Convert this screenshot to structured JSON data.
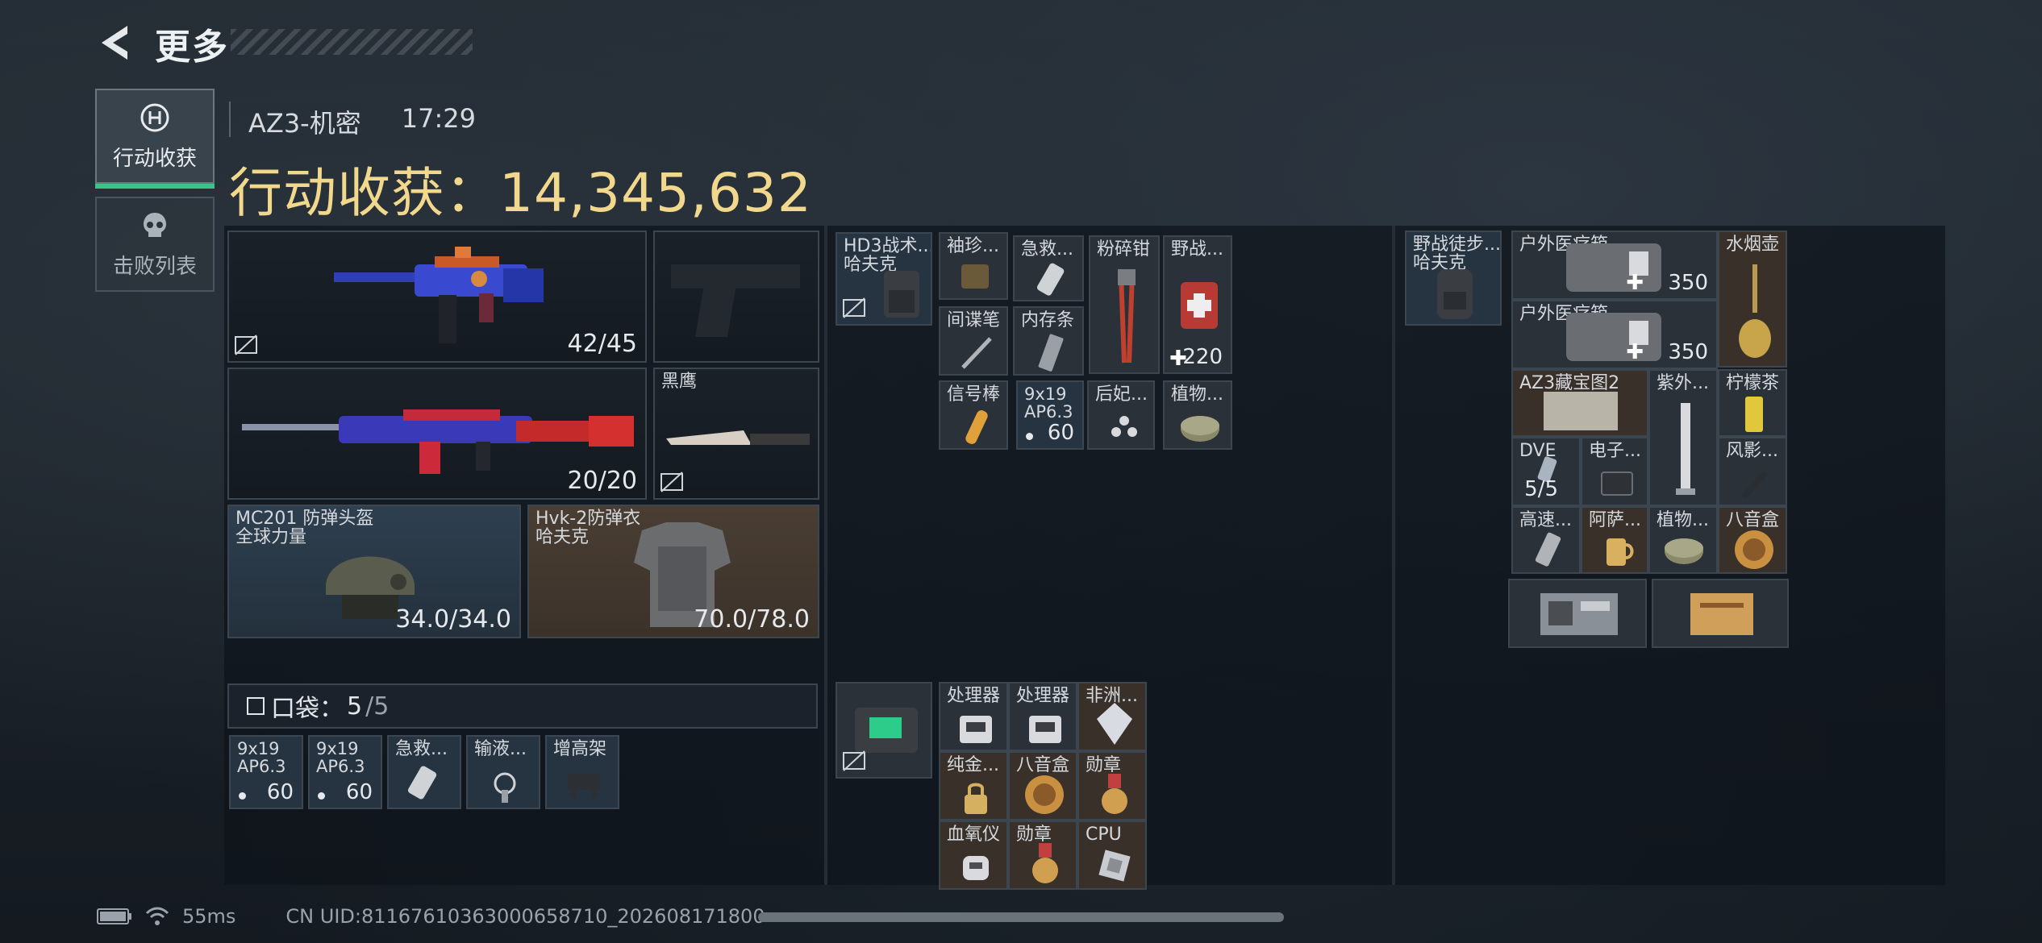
{
  "header": {
    "title": "更多"
  },
  "tabs": [
    {
      "label": "行动收获",
      "active": true
    },
    {
      "label": "击败列表",
      "active": false
    }
  ],
  "session": {
    "map": "AZ3-机密",
    "time": "17:29",
    "earnings_label": "行动收获：",
    "earnings_value": "14,345,632"
  },
  "loadout": {
    "primary_ammo": "42/45",
    "secondary_ammo": "20/20",
    "melee_name": "黑鹰",
    "helmet": {
      "name": "MC201 防弹头盔",
      "brand": "全球力量",
      "durability": "34.0/34.0"
    },
    "armor": {
      "name": "Hvk-2防弹衣",
      "brand": "哈夫克",
      "durability": "70.0/78.0"
    }
  },
  "pocket": {
    "label": "口袋：",
    "count": "5",
    "capacity": "/5",
    "items": [
      {
        "line1": "9x19",
        "line2": "AP6.3",
        "qty": "60"
      },
      {
        "line1": "9x19",
        "line2": "AP6.3",
        "qty": "60"
      },
      {
        "line1": "急救...",
        "line2": "",
        "qty": ""
      },
      {
        "line1": "输液...",
        "line2": "",
        "qty": ""
      },
      {
        "line1": "增高架",
        "line2": "",
        "qty": ""
      }
    ]
  },
  "chest_rig": {
    "name": "HD3战术...",
    "brand": "哈夫克",
    "items": {
      "a": "袖珍...",
      "b": "急救...",
      "c": "粉碎钳",
      "d": "野战...",
      "d_value": "220",
      "e": "间谍笔",
      "f": "内存条",
      "g": "信号棒",
      "h": "9x19",
      "h2": "AP6.3",
      "h_qty": "60",
      "i": "后妃...",
      "j": "植物..."
    }
  },
  "case": {
    "items": [
      "处理器",
      "处理器",
      "非洲...",
      "纯金...",
      "八音盒",
      "勋章",
      "血氧仪",
      "勋章",
      "CPU"
    ]
  },
  "backpack": {
    "name": "野战徒步...",
    "brand": "哈夫克",
    "items": {
      "med1": "户外医疗箱",
      "med1_value": "350",
      "med2": "户外医疗箱",
      "med2_value": "350",
      "hookah": "水烟壶",
      "map": "AZ3藏宝图2",
      "uv": "紫外...",
      "tea": "柠檬茶",
      "dve": "DVE",
      "dve_count": "5/5",
      "elec": "电子...",
      "shadow": "风影...",
      "hs": "高速...",
      "aru": "阿萨...",
      "plant": "植物...",
      "music": "八音盒"
    }
  },
  "status": {
    "ping": "55ms",
    "uid": "CN UID:81167610363000658710_202608171800"
  }
}
